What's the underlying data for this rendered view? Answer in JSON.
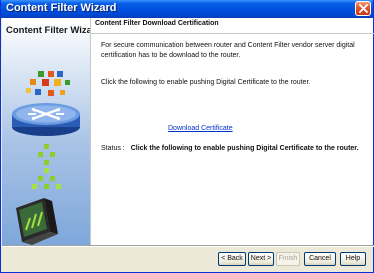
{
  "window": {
    "title": "Content Filter Wizard"
  },
  "left_panel": {
    "title": "Content Filter Wizard"
  },
  "main": {
    "section_title": "Content Filter Download Certification",
    "paragraph1": "For secure communication between router and Content Filter vendor server digital certification has to be download to the router.",
    "paragraph2": "Click the following to enable pushing Digital Certificate to the router.",
    "download_link": "Download Certificate",
    "status_label": "Status :",
    "status_value": "Click the following to enable pushing Digital Certificate to the router."
  },
  "buttons": {
    "back": "< Back",
    "next": "Next >",
    "finish": "Finish",
    "cancel": "Cancel",
    "help": "Help"
  },
  "colors": {
    "titlebar": "#0050e0",
    "link": "#0033cc",
    "panel_gradient_end": "#7ea7da"
  },
  "icons": [
    "close-icon",
    "router-illustration",
    "network-squares-decoration",
    "pc-monitor-illustration"
  ]
}
